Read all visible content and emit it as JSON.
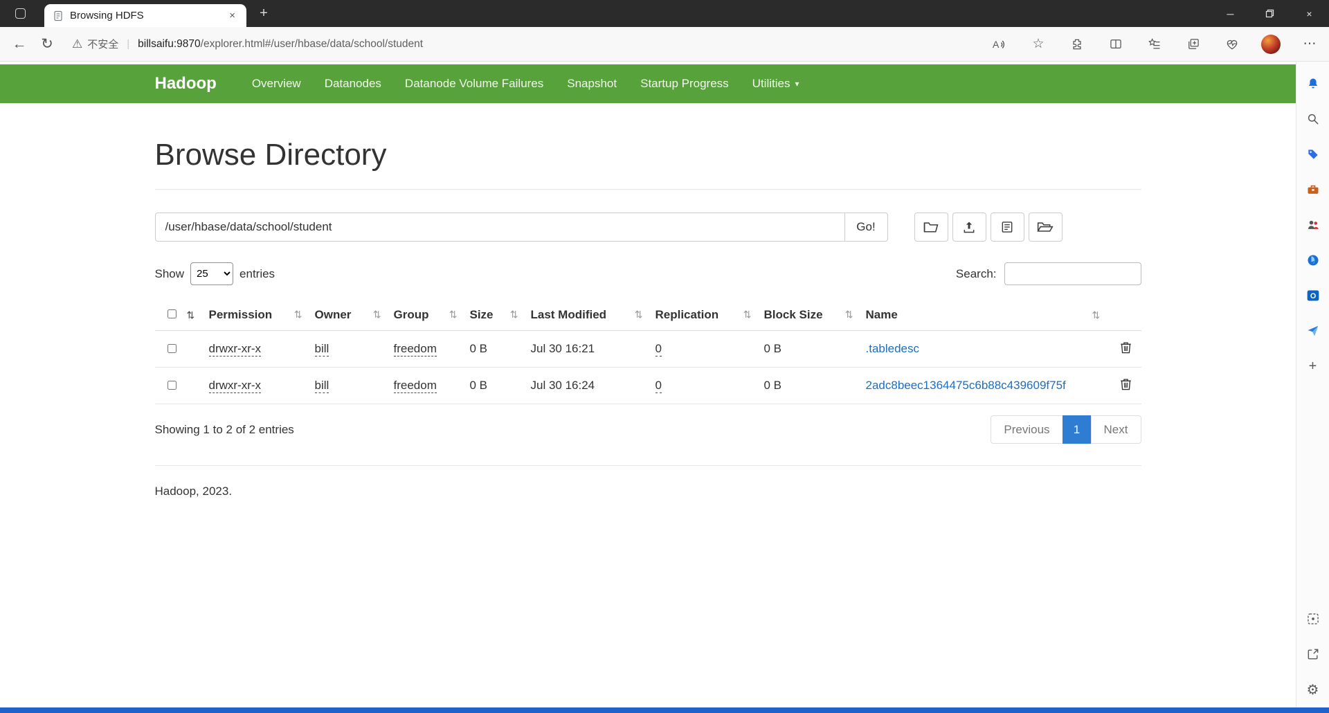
{
  "colors": {
    "navbar_green": "#57a23a",
    "link_blue": "#1a6fc4",
    "pagination_active_blue": "#2e7dd2",
    "taskbar_blue": "#2062cc",
    "titlebar_dark": "#2b2b2b"
  },
  "icons": {
    "back": "←",
    "refresh": "↻",
    "warning": "⚠",
    "divider": "|",
    "read_aloud": "A",
    "star": "☆",
    "more": "⋯",
    "minimize": "─",
    "close": "×",
    "plus": "+",
    "sort": "⇅",
    "caret": "▾",
    "gear": "⚙"
  },
  "browser": {
    "tab_title": "Browsing HDFS",
    "security_label": "不安全",
    "url_host": "billsaifu:9870",
    "url_path": "/explorer.html#/user/hbase/data/school/student"
  },
  "navbar": {
    "brand": "Hadoop",
    "items": [
      "Overview",
      "Datanodes",
      "Datanode Volume Failures",
      "Snapshot",
      "Startup Progress",
      "Utilities"
    ]
  },
  "page": {
    "title": "Browse Directory",
    "path_value": "/user/hbase/data/school/student",
    "go_label": "Go!",
    "show_label": "Show",
    "entries_value": "25",
    "entries_label": "entries",
    "search_label": "Search:",
    "summary": "Showing 1 to 2 of 2 entries",
    "footer": "Hadoop, 2023."
  },
  "pagination": {
    "previous_label": "Previous",
    "page_label": "1",
    "next_label": "Next"
  },
  "table": {
    "columns": [
      "Permission",
      "Owner",
      "Group",
      "Size",
      "Last Modified",
      "Replication",
      "Block Size",
      "Name"
    ],
    "rows": [
      {
        "permission": "drwxr-xr-x",
        "owner": "bill",
        "group": "freedom",
        "size": "0 B",
        "modified": "Jul 30 16:21",
        "replication": "0",
        "block_size": "0 B",
        "name": ".tabledesc"
      },
      {
        "permission": "drwxr-xr-x",
        "owner": "bill",
        "group": "freedom",
        "size": "0 B",
        "modified": "Jul 30 16:24",
        "replication": "0",
        "block_size": "0 B",
        "name": "2adc8beec1364475c6b88c439609f75f"
      }
    ]
  }
}
